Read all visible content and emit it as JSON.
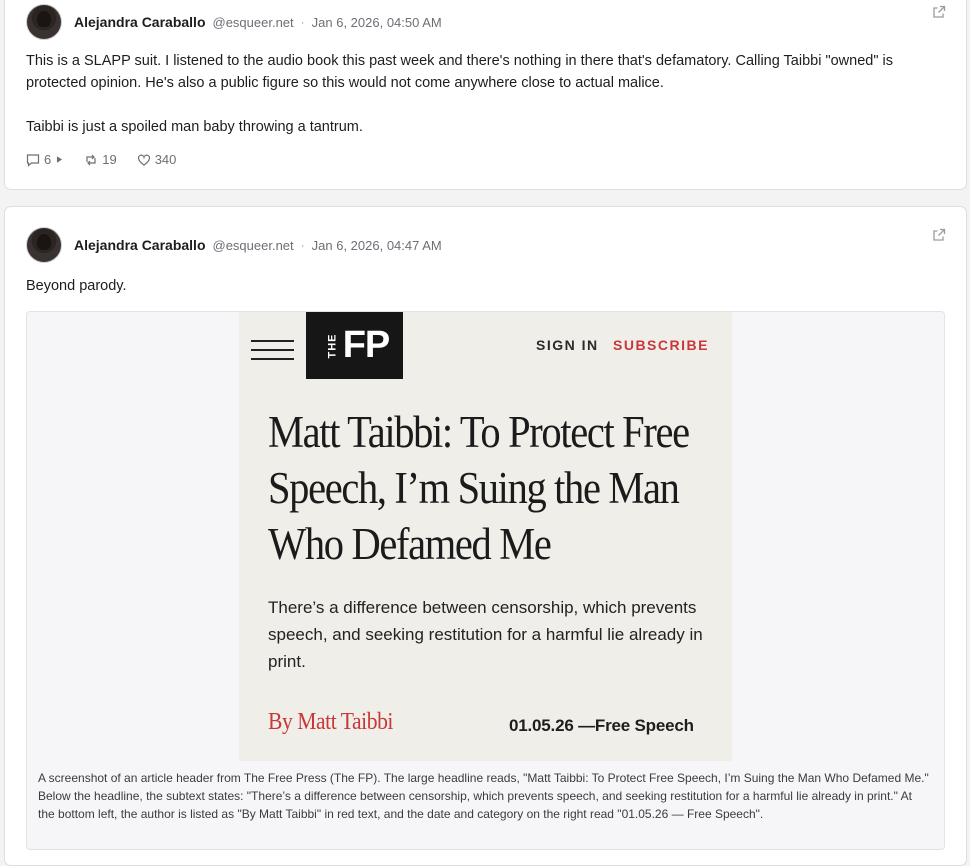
{
  "posts": [
    {
      "author_name": "Alejandra Caraballo",
      "handle": "@esqueer.net",
      "separator": "·",
      "timestamp": "Jan 6, 2026, 04:50 AM",
      "paragraphs": [
        "This is a SLAPP suit. I listened to the audio book this past week and there's nothing in there that's defamatory. Calling Taibbi \"owned\" is protected opinion. He's also a public figure so this would not come anywhere close to actual malice.",
        "Taibbi is just a spoiled man baby throwing a tantrum."
      ],
      "replies": "6",
      "reposts": "19",
      "likes": "340"
    },
    {
      "author_name": "Alejandra Caraballo",
      "handle": "@esqueer.net",
      "separator": "·",
      "timestamp": "Jan 6, 2026, 04:47 AM",
      "paragraphs": [
        "Beyond parody."
      ],
      "embed": {
        "logo_the": "THE",
        "logo_fp": "FP",
        "sign_in": "SIGN IN",
        "subscribe": "SUBSCRIBE",
        "headline": "Matt Taibbi: To Protect Free Speech, I’m Suing the Man Who Defamed Me",
        "deck": "There’s a difference between censorship, which prevents speech, and seeking restitution for a harmful lie already in print.",
        "byline": "By Matt Taibbi",
        "dateline": "01.05.26 —Free Speech",
        "brand_red": "#c8383a"
      },
      "alt_text": "A screenshot of an article header from The Free Press (The FP). The large headline reads, \"Matt Taibbi: To Protect Free Speech, I’m Suing the Man Who Defamed Me.\" Below the headline, the subtext states: \"There’s a difference between censorship, which prevents speech, and seeking restitution for a harmful lie already in print.\" At the bottom left, the author is listed as \"By Matt Taibbi\" in red text, and the date and category on the right read \"01.05.26 — Free Speech\"."
    }
  ],
  "icons": {
    "reply": "speech-bubble-icon",
    "play": "play-triangle-icon",
    "repost": "repost-icon",
    "like": "heart-icon",
    "external": "external-link-icon",
    "menu": "hamburger-menu-icon"
  }
}
